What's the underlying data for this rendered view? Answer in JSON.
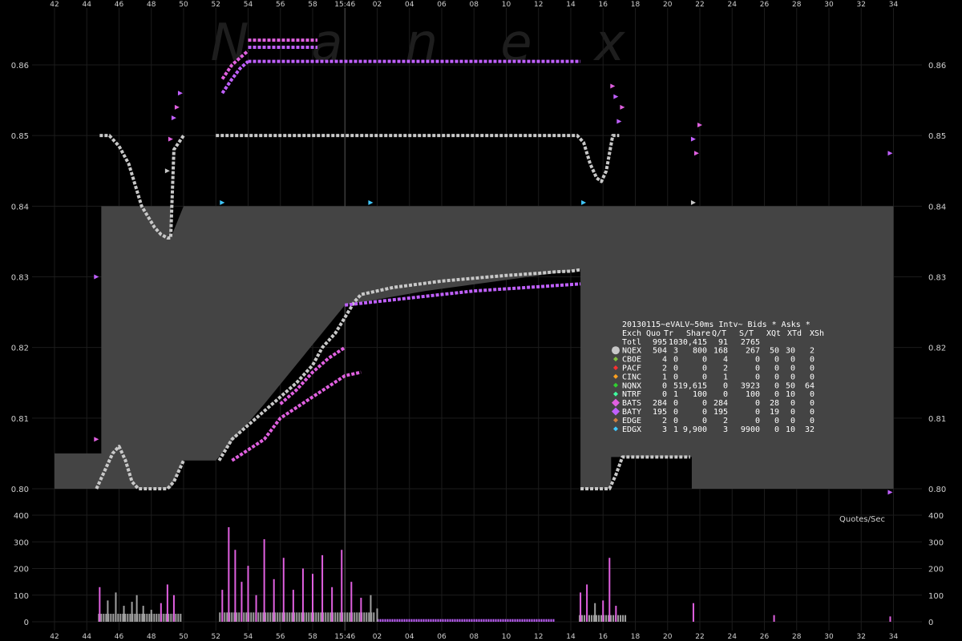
{
  "watermark": "Nanex",
  "chart_data": {
    "type": "line",
    "time_ticks": [
      "42",
      "44",
      "46",
      "48",
      "50",
      "52",
      "54",
      "56",
      "58",
      "15:46",
      "02",
      "04",
      "06",
      "08",
      "10",
      "12",
      "14",
      "16",
      "18",
      "20",
      "22",
      "24",
      "26",
      "28",
      "30",
      "32",
      "34"
    ],
    "price_axis": {
      "ticks": [
        "0.80",
        "0.81",
        "0.82",
        "0.83",
        "0.84",
        "0.85",
        "0.86"
      ],
      "ylim": [
        0.8,
        0.866
      ]
    },
    "volume_axis": {
      "title": "Quotes/Sec",
      "ticks": [
        "0",
        "100",
        "200",
        "300",
        "400"
      ],
      "ylim": [
        0,
        400
      ]
    },
    "nbbo_region": [
      [
        42.0,
        0.8,
        0.805
      ],
      [
        44.9,
        0.8,
        0.805
      ],
      [
        44.9,
        0.8,
        0.84
      ],
      [
        49.2,
        0.8,
        0.84
      ],
      [
        49.2,
        0.8,
        0.8355
      ],
      [
        50.0,
        0.804,
        0.84
      ],
      [
        52.0,
        0.804,
        0.84
      ],
      [
        55.0,
        0.812,
        0.84
      ],
      [
        60.0,
        0.826,
        0.84
      ],
      [
        65.0,
        0.828,
        0.84
      ],
      [
        74.6,
        0.831,
        0.84
      ],
      [
        74.6,
        0.8,
        0.84
      ],
      [
        76.5,
        0.8,
        0.84
      ],
      [
        76.5,
        0.8045,
        0.84
      ],
      [
        81.5,
        0.8045,
        0.84
      ],
      [
        81.5,
        0.8,
        0.84
      ],
      [
        94.0,
        0.8,
        0.84
      ]
    ],
    "series": [
      {
        "name": "NQEX",
        "color": "#c8c8c8",
        "x": [
          44.8,
          45.4,
          46.0,
          46.6,
          47.0,
          47.4,
          47.8,
          48.2,
          48.6,
          49.0,
          49.2,
          49.4,
          50.0
        ],
        "y": [
          0.85,
          0.85,
          0.8485,
          0.846,
          0.843,
          0.84,
          0.8385,
          0.837,
          0.836,
          0.8355,
          0.8355,
          0.848,
          0.85
        ]
      },
      {
        "name": "NQEX",
        "color": "#c8c8c8",
        "x": [
          52.0,
          54.0,
          56.0,
          58.0,
          60.0,
          62.0,
          64.0,
          66.0,
          68.0,
          70.0,
          72.0,
          74.4,
          74.8,
          75.2,
          75.6,
          75.9,
          76.2,
          76.6,
          77.0
        ],
        "y": [
          0.85,
          0.85,
          0.85,
          0.85,
          0.85,
          0.85,
          0.85,
          0.85,
          0.85,
          0.85,
          0.85,
          0.85,
          0.849,
          0.846,
          0.844,
          0.8435,
          0.845,
          0.85,
          0.85
        ]
      },
      {
        "name": "NQEX",
        "color": "#c8c8c8",
        "x": [
          44.6,
          45.2,
          45.6,
          46.0,
          46.4,
          46.8,
          47.2,
          48.0,
          48.6,
          49.0,
          49.4,
          49.8,
          50.0
        ],
        "y": [
          0.8,
          0.803,
          0.805,
          0.806,
          0.804,
          0.801,
          0.8,
          0.8,
          0.8,
          0.8,
          0.801,
          0.803,
          0.804
        ]
      },
      {
        "name": "NQEX",
        "color": "#c8c8c8",
        "x": [
          52.2,
          53.0,
          54.0,
          55.0,
          56.0,
          57.0,
          58.0,
          58.6,
          59.0,
          59.4,
          59.8,
          60.2,
          60.6,
          61.0,
          62.0,
          63.0,
          64.0,
          65.0,
          66.0,
          68.0,
          70.0,
          72.0,
          73.0,
          74.0,
          74.6
        ],
        "y": [
          0.804,
          0.807,
          0.809,
          0.811,
          0.813,
          0.815,
          0.8175,
          0.82,
          0.821,
          0.822,
          0.8235,
          0.825,
          0.8265,
          0.8275,
          0.828,
          0.8285,
          0.8288,
          0.8291,
          0.8294,
          0.8298,
          0.8302,
          0.8305,
          0.8307,
          0.8308,
          0.831
        ]
      },
      {
        "name": "NQEX",
        "color": "#c8c8c8",
        "x": [
          74.6,
          75.2,
          75.8,
          76.4,
          76.8,
          77.2,
          78.0,
          80.0,
          81.4
        ],
        "y": [
          0.8,
          0.8,
          0.8,
          0.8,
          0.802,
          0.8045,
          0.8045,
          0.8045,
          0.8045
        ]
      },
      {
        "name": "BATS",
        "color": "#e060e0",
        "x": [
          53.0,
          55.0,
          56.0,
          58.0,
          60.0,
          61.0
        ],
        "y": [
          0.804,
          0.807,
          0.81,
          0.813,
          0.816,
          0.8165
        ]
      },
      {
        "name": "BATS",
        "color": "#e060e0",
        "x": [
          56.0,
          57.0,
          58.0,
          59.0,
          60.0
        ],
        "y": [
          0.812,
          0.814,
          0.8165,
          0.8185,
          0.82
        ]
      },
      {
        "name": "BATY",
        "color": "#c060ff",
        "x": [
          60.0,
          62.0,
          64.0,
          66.0,
          68.0,
          70.0,
          72.0,
          74.6
        ],
        "y": [
          0.826,
          0.8265,
          0.827,
          0.8275,
          0.828,
          0.8283,
          0.8286,
          0.829
        ]
      },
      {
        "name": "BATS",
        "color": "#e060e0",
        "x": [
          54.0,
          58.3
        ],
        "y": [
          0.8635,
          0.8635
        ]
      },
      {
        "name": "BATY",
        "color": "#c060ff",
        "x": [
          54.0,
          58.3
        ],
        "y": [
          0.8625,
          0.8625
        ]
      },
      {
        "name": "BATY",
        "color": "#c060ff",
        "x": [
          54.0,
          74.6
        ],
        "y": [
          0.8605,
          0.8605
        ]
      },
      {
        "name": "BATS",
        "color": "#e060e0",
        "x": [
          52.4,
          53.0,
          53.5,
          54.0
        ],
        "y": [
          0.858,
          0.86,
          0.861,
          0.862
        ]
      },
      {
        "name": "BATY",
        "color": "#c060ff",
        "x": [
          52.4,
          53.0,
          53.5,
          54.0
        ],
        "y": [
          0.856,
          0.858,
          0.8595,
          0.8605
        ]
      }
    ],
    "points": [
      {
        "name": "EDGX",
        "color": "#40c8ff",
        "x": 52.4,
        "y": 0.8405
      },
      {
        "name": "EDGX",
        "color": "#40c8ff",
        "x": 61.6,
        "y": 0.8405
      },
      {
        "name": "EDGX",
        "color": "#40c8ff",
        "x": 74.8,
        "y": 0.8405
      },
      {
        "name": "NQEX",
        "color": "#c8c8c8",
        "x": 81.6,
        "y": 0.8405
      },
      {
        "name": "NQEX",
        "color": "#c8c8c8",
        "x": 49.0,
        "y": 0.845
      },
      {
        "name": "BATS",
        "color": "#e060e0",
        "x": 49.2,
        "y": 0.8495
      },
      {
        "name": "BATY",
        "color": "#c060ff",
        "x": 49.4,
        "y": 0.8525
      },
      {
        "name": "BATS",
        "color": "#e060e0",
        "x": 49.6,
        "y": 0.854
      },
      {
        "name": "BATY",
        "color": "#c060ff",
        "x": 49.8,
        "y": 0.856
      },
      {
        "name": "BATS",
        "color": "#e060e0",
        "x": 76.6,
        "y": 0.857
      },
      {
        "name": "BATY",
        "color": "#c060ff",
        "x": 76.8,
        "y": 0.8555
      },
      {
        "name": "BATS",
        "color": "#e060e0",
        "x": 77.2,
        "y": 0.854
      },
      {
        "name": "BATY",
        "color": "#c060ff",
        "x": 77.0,
        "y": 0.852
      },
      {
        "name": "BATS",
        "color": "#e060e0",
        "x": 82.0,
        "y": 0.8515
      },
      {
        "name": "BATY",
        "color": "#c060ff",
        "x": 81.6,
        "y": 0.8495
      },
      {
        "name": "BATS",
        "color": "#e060e0",
        "x": 81.8,
        "y": 0.8475
      },
      {
        "name": "BATY",
        "color": "#c060ff",
        "x": 93.8,
        "y": 0.8475
      },
      {
        "name": "BATS",
        "color": "#e060e0",
        "x": 44.6,
        "y": 0.807
      },
      {
        "name": "BATY",
        "color": "#c060ff",
        "x": 44.6,
        "y": 0.83
      },
      {
        "name": "BATY",
        "color": "#c060ff",
        "x": 93.8,
        "y": 0.7995
      }
    ],
    "volume_bars": [
      {
        "x": 44.8,
        "value": 130,
        "color": "#e060e0"
      },
      {
        "x": 45.3,
        "value": 80,
        "color": "#a0a0a0"
      },
      {
        "x": 45.8,
        "value": 110,
        "color": "#a0a0a0"
      },
      {
        "x": 46.3,
        "value": 60,
        "color": "#a0a0a0"
      },
      {
        "x": 46.8,
        "value": 75,
        "color": "#a0a0a0"
      },
      {
        "x": 47.1,
        "value": 100,
        "color": "#a0a0a0"
      },
      {
        "x": 47.5,
        "value": 60,
        "color": "#a0a0a0"
      },
      {
        "x": 48.0,
        "value": 45,
        "color": "#a0a0a0"
      },
      {
        "x": 48.6,
        "value": 70,
        "color": "#e060e0"
      },
      {
        "x": 49.0,
        "value": 140,
        "color": "#e060e0"
      },
      {
        "x": 49.4,
        "value": 100,
        "color": "#e060e0"
      },
      {
        "x": 52.4,
        "value": 120,
        "color": "#e060e0"
      },
      {
        "x": 52.8,
        "value": 355,
        "color": "#e060e0"
      },
      {
        "x": 53.2,
        "value": 270,
        "color": "#e060e0"
      },
      {
        "x": 53.6,
        "value": 150,
        "color": "#e060e0"
      },
      {
        "x": 54.0,
        "value": 210,
        "color": "#e060e0"
      },
      {
        "x": 54.5,
        "value": 100,
        "color": "#e060e0"
      },
      {
        "x": 55.0,
        "value": 310,
        "color": "#e060e0"
      },
      {
        "x": 55.6,
        "value": 160,
        "color": "#e060e0"
      },
      {
        "x": 56.2,
        "value": 240,
        "color": "#e060e0"
      },
      {
        "x": 56.8,
        "value": 120,
        "color": "#e060e0"
      },
      {
        "x": 57.4,
        "value": 200,
        "color": "#e060e0"
      },
      {
        "x": 58.0,
        "value": 180,
        "color": "#e060e0"
      },
      {
        "x": 58.6,
        "value": 250,
        "color": "#e060e0"
      },
      {
        "x": 59.2,
        "value": 130,
        "color": "#e060e0"
      },
      {
        "x": 59.8,
        "value": 270,
        "color": "#e060e0"
      },
      {
        "x": 60.4,
        "value": 150,
        "color": "#e060e0"
      },
      {
        "x": 61.0,
        "value": 90,
        "color": "#e060e0"
      },
      {
        "x": 61.6,
        "value": 100,
        "color": "#a0a0a0"
      },
      {
        "x": 62.0,
        "value": 50,
        "color": "#a0a0a0"
      },
      {
        "x": 74.6,
        "value": 110,
        "color": "#e060e0"
      },
      {
        "x": 75.0,
        "value": 140,
        "color": "#e060e0"
      },
      {
        "x": 75.5,
        "value": 70,
        "color": "#a0a0a0"
      },
      {
        "x": 76.0,
        "value": 80,
        "color": "#e060e0"
      },
      {
        "x": 76.4,
        "value": 240,
        "color": "#e060e0"
      },
      {
        "x": 76.8,
        "value": 60,
        "color": "#e060e0"
      },
      {
        "x": 81.6,
        "value": 70,
        "color": "#e060e0"
      },
      {
        "x": 86.6,
        "value": 25,
        "color": "#e060e0"
      },
      {
        "x": 93.8,
        "value": 20,
        "color": "#e060e0"
      }
    ],
    "volume_base_segments": [
      {
        "x0": 44.7,
        "x1": 49.8,
        "value": 30,
        "color": "#a0a0a0"
      },
      {
        "x0": 52.2,
        "x1": 61.8,
        "value": 35,
        "color": "#a0a0a0"
      },
      {
        "x0": 62.0,
        "x1": 73.0,
        "value": 10,
        "color": "#c060ff"
      },
      {
        "x0": 74.5,
        "x1": 77.4,
        "value": 25,
        "color": "#a0a0a0"
      }
    ],
    "cursor_x": 60.0
  },
  "legend": {
    "title": "20130115~eVALV~50ms Intv~ Bids * Asks *",
    "header": [
      "Exch",
      "Quo",
      "Tr",
      "Share",
      "Q/T",
      "S/T",
      "XQt",
      "XTd",
      "XSh"
    ],
    "rows": [
      {
        "exch": "Totl",
        "quo": "995",
        "tr": "10",
        "share": "30,415",
        "qt": "91",
        "st": "2765",
        "xqt": "",
        "xtd": "",
        "xsh": "",
        "color": ""
      },
      {
        "exch": "NQEX",
        "quo": "504",
        "tr": "3",
        "share": "800",
        "qt": "168",
        "st": "267",
        "xqt": "50",
        "xtd": "30",
        "xsh": "2",
        "color": "#c8c8c8"
      },
      {
        "exch": "CBOE",
        "quo": "4",
        "tr": "0",
        "share": "0",
        "qt": "4",
        "st": "0",
        "xqt": "0",
        "xtd": "0",
        "xsh": "0",
        "color": "#80c040"
      },
      {
        "exch": "PACF",
        "quo": "2",
        "tr": "0",
        "share": "0",
        "qt": "2",
        "st": "0",
        "xqt": "0",
        "xtd": "0",
        "xsh": "0",
        "color": "#ff3030"
      },
      {
        "exch": "CINC",
        "quo": "1",
        "tr": "0",
        "share": "0",
        "qt": "1",
        "st": "0",
        "xqt": "0",
        "xtd": "0",
        "xsh": "0",
        "color": "#ffa020"
      },
      {
        "exch": "NQNX",
        "quo": "0",
        "tr": "5",
        "share": "19,615",
        "qt": "0",
        "st": "3923",
        "xqt": "0",
        "xtd": "50",
        "xsh": "64",
        "color": "#30d030"
      },
      {
        "exch": "NTRF",
        "quo": "0",
        "tr": "1",
        "share": "100",
        "qt": "0",
        "st": "100",
        "xqt": "0",
        "xtd": "10",
        "xsh": "0",
        "color": "#40ffa0"
      },
      {
        "exch": "BATS",
        "quo": "284",
        "tr": "0",
        "share": "0",
        "qt": "284",
        "st": "0",
        "xqt": "28",
        "xtd": "0",
        "xsh": "0",
        "color": "#e060e0"
      },
      {
        "exch": "BATY",
        "quo": "195",
        "tr": "0",
        "share": "0",
        "qt": "195",
        "st": "0",
        "xqt": "19",
        "xtd": "0",
        "xsh": "0",
        "color": "#c060ff"
      },
      {
        "exch": "EDGE",
        "quo": "2",
        "tr": "0",
        "share": "0",
        "qt": "2",
        "st": "0",
        "xqt": "0",
        "xtd": "0",
        "xsh": "0",
        "color": "#d08040"
      },
      {
        "exch": "EDGX",
        "quo": "3",
        "tr": "1",
        "share": "9,900",
        "qt": "3",
        "st": "9900",
        "xqt": "0",
        "xtd": "10",
        "xsh": "32",
        "color": "#40c8ff"
      }
    ]
  }
}
